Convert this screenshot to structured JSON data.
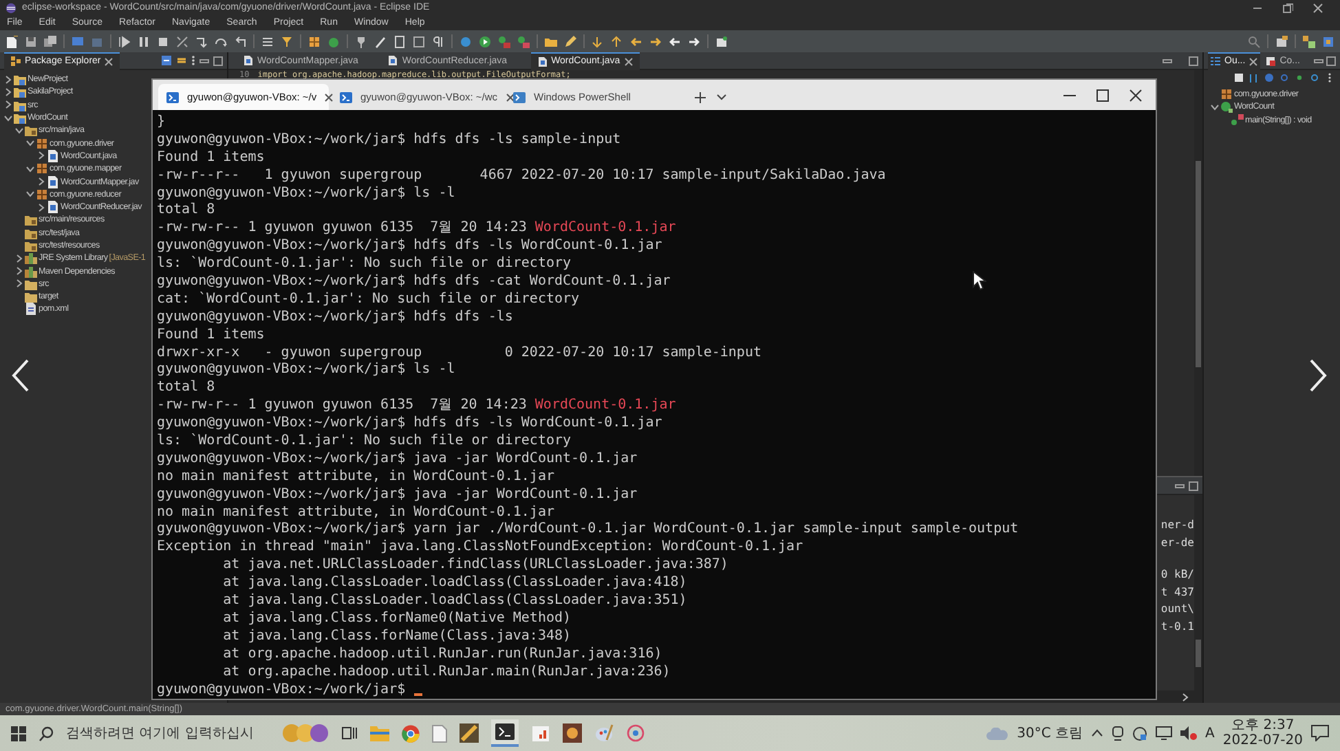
{
  "eclipse": {
    "title": "eclipse-workspace - WordCount/src/main/java/com/gyuone/driver/WordCount.java - Eclipse IDE",
    "menu": [
      "File",
      "Edit",
      "Source",
      "Refactor",
      "Navigate",
      "Search",
      "Project",
      "Run",
      "Window",
      "Help"
    ],
    "package_explorer": {
      "title": "Package Explorer",
      "tree": [
        {
          "label": "NewProject",
          "kind": "project",
          "expanded": false
        },
        {
          "label": "SakilaProject",
          "kind": "project",
          "expanded": false
        },
        {
          "label": "src",
          "kind": "project",
          "expanded": false
        },
        {
          "label": "WordCount",
          "kind": "project",
          "expanded": true,
          "children": [
            {
              "label": "src/main/java",
              "kind": "source-folder",
              "expanded": true,
              "children": [
                {
                  "label": "com.gyuone.driver",
                  "kind": "package",
                  "expanded": true,
                  "children": [
                    {
                      "label": "WordCount.java",
                      "kind": "java",
                      "expanded": false
                    }
                  ]
                },
                {
                  "label": "com.gyuone.mapper",
                  "kind": "package",
                  "expanded": true,
                  "children": [
                    {
                      "label": "WordCountMapper.jav",
                      "kind": "java",
                      "expanded": false
                    }
                  ]
                },
                {
                  "label": "com.gyuone.reducer",
                  "kind": "package",
                  "expanded": true,
                  "children": [
                    {
                      "label": "WordCountReducer.jav",
                      "kind": "java",
                      "expanded": false
                    }
                  ]
                }
              ]
            },
            {
              "label": "src/main/resources",
              "kind": "source-folder"
            },
            {
              "label": "src/test/java",
              "kind": "source-folder"
            },
            {
              "label": "src/test/resources",
              "kind": "source-folder"
            },
            {
              "label": "JRE System Library",
              "decoration": "[JavaSE-1",
              "kind": "library",
              "expanded": false
            },
            {
              "label": "Maven Dependencies",
              "kind": "library",
              "expanded": false
            },
            {
              "label": "src",
              "kind": "folder",
              "expanded": false
            },
            {
              "label": "target",
              "kind": "folder"
            },
            {
              "label": "pom.xml",
              "kind": "xml"
            }
          ]
        }
      ]
    },
    "editor": {
      "tabs": [
        {
          "label": "WordCountMapper.java",
          "selected": false
        },
        {
          "label": "WordCountReducer.java",
          "selected": false
        },
        {
          "label": "WordCount.java",
          "selected": true
        }
      ],
      "code": [
        {
          "number": "10",
          "text": "import org.apache.hadoop.mapreduce.lib.output.FileOutputFormat;"
        }
      ]
    },
    "console": {
      "blocks": [
        {
          "lines": [
            "ner-d",
            "er-de"
          ]
        },
        {
          "lines": [
            "0 kB/",
            "t 437",
            "ount\\",
            "t-0.1"
          ]
        }
      ]
    },
    "outline": {
      "tabs": [
        {
          "label": "Ou...",
          "selected": true
        },
        {
          "label": "Co...",
          "selected": false
        }
      ],
      "tree": [
        {
          "label": "com.gyuone.driver",
          "kind": "package"
        },
        {
          "label": "WordCount",
          "kind": "class",
          "expanded": true,
          "children": [
            {
              "label": "main(String[]) : void",
              "kind": "method"
            }
          ]
        }
      ]
    },
    "status_bar": "com.gyuone.driver.WordCount.main(String[])"
  },
  "terminal": {
    "tabs": [
      {
        "label": "gyuwon@gyuwon-VBox: ~/v",
        "selected": true
      },
      {
        "label": "gyuwon@gyuwon-VBox: ~/wc",
        "selected": false
      },
      {
        "label": "Windows PowerShell",
        "selected": false
      }
    ],
    "lines": [
      {
        "text": "}"
      },
      {
        "text": "gyuwon@gyuwon-VBox:~/work/jar$ hdfs dfs -ls sample-input"
      },
      {
        "text": "Found 1 items"
      },
      {
        "text": "-rw-r--r--   1 gyuwon supergroup       4667 2022-07-20 10:17 sample-input/SakilaDao.java"
      },
      {
        "text": "gyuwon@gyuwon-VBox:~/work/jar$ ls -l"
      },
      {
        "text": "total 8"
      },
      {
        "text": "-rw-rw-r-- 1 gyuwon gyuwon 6135  7월 20 14:23 ",
        "red": "WordCount-0.1.jar"
      },
      {
        "text": "gyuwon@gyuwon-VBox:~/work/jar$ hdfs dfs -ls WordCount-0.1.jar"
      },
      {
        "text": "ls: `WordCount-0.1.jar': No such file or directory"
      },
      {
        "text": "gyuwon@gyuwon-VBox:~/work/jar$ hdfs dfs -cat WordCount-0.1.jar"
      },
      {
        "text": "cat: `WordCount-0.1.jar': No such file or directory"
      },
      {
        "text": "gyuwon@gyuwon-VBox:~/work/jar$ hdfs dfs -ls"
      },
      {
        "text": "Found 1 items"
      },
      {
        "text": "drwxr-xr-x   - gyuwon supergroup          0 2022-07-20 10:17 sample-input"
      },
      {
        "text": "gyuwon@gyuwon-VBox:~/work/jar$ ls -l"
      },
      {
        "text": "total 8"
      },
      {
        "text": "-rw-rw-r-- 1 gyuwon gyuwon 6135  7월 20 14:23 ",
        "red": "WordCount-0.1.jar"
      },
      {
        "text": "gyuwon@gyuwon-VBox:~/work/jar$ hdfs dfs -ls WordCount-0.1.jar"
      },
      {
        "text": "ls: `WordCount-0.1.jar': No such file or directory"
      },
      {
        "text": "gyuwon@gyuwon-VBox:~/work/jar$ java -jar WordCount-0.1.jar"
      },
      {
        "text": "no main manifest attribute, in WordCount-0.1.jar"
      },
      {
        "text": "gyuwon@gyuwon-VBox:~/work/jar$ java -jar WordCount-0.1.jar"
      },
      {
        "text": "no main manifest attribute, in WordCount-0.1.jar"
      },
      {
        "text": "gyuwon@gyuwon-VBox:~/work/jar$ yarn jar ./WordCount-0.1.jar WordCount-0.1.jar sample-input sample-output"
      },
      {
        "text": "Exception in thread \"main\" java.lang.ClassNotFoundException: WordCount-0.1.jar"
      },
      {
        "text": "        at java.net.URLClassLoader.findClass(URLClassLoader.java:387)"
      },
      {
        "text": "        at java.lang.ClassLoader.loadClass(ClassLoader.java:418)"
      },
      {
        "text": "        at java.lang.ClassLoader.loadClass(ClassLoader.java:351)"
      },
      {
        "text": "        at java.lang.Class.forName0(Native Method)"
      },
      {
        "text": "        at java.lang.Class.forName(Class.java:348)"
      },
      {
        "text": "        at org.apache.hadoop.util.RunJar.run(RunJar.java:316)"
      },
      {
        "text": "        at org.apache.hadoop.util.RunJar.main(RunJar.java:236)"
      },
      {
        "text": "gyuwon@gyuwon-VBox:~/work/jar$ "
      }
    ],
    "cursor": true
  },
  "taskbar": {
    "search": {
      "placeholder": "검색하려면 여기에 입력하십시"
    },
    "weather": "30°C 흐림",
    "input_indicator": "A",
    "time": "오후 2:37",
    "date": "2022-07-20"
  }
}
